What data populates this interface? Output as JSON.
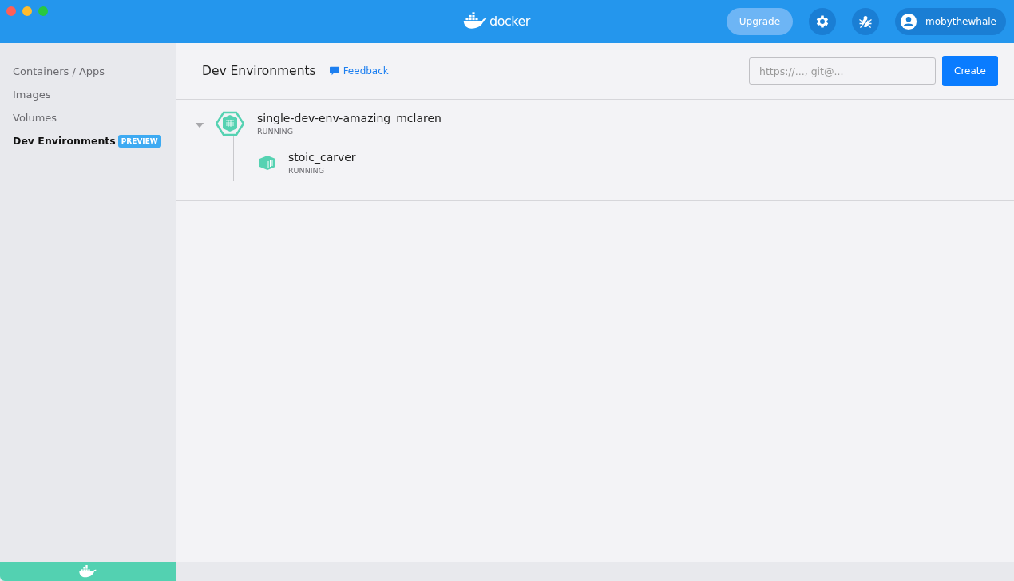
{
  "titlebar": {
    "logo": "docker",
    "upgrade": "Upgrade",
    "user": "mobythewhale"
  },
  "sidebar": {
    "items": [
      {
        "label": "Containers / Apps",
        "selected": false
      },
      {
        "label": "Images",
        "selected": false
      },
      {
        "label": "Volumes",
        "selected": false
      },
      {
        "label": "Dev Environments",
        "selected": true,
        "badge": "PREVIEW"
      }
    ]
  },
  "header": {
    "title": "Dev Environments",
    "feedback": "Feedback",
    "repo_placeholder": "https://..., git@...",
    "create": "Create"
  },
  "environments": [
    {
      "name": "single-dev-env-amazing_mclaren",
      "status": "RUNNING",
      "expanded": true,
      "children": [
        {
          "name": "stoic_carver",
          "status": "RUNNING"
        }
      ]
    }
  ]
}
